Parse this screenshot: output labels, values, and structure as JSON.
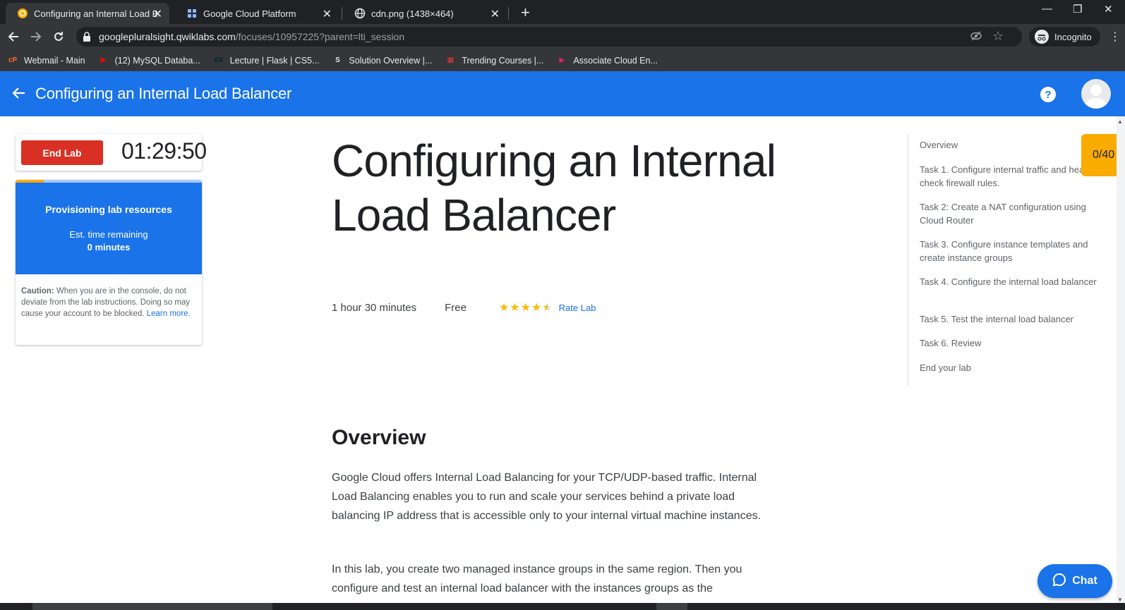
{
  "browser": {
    "tabs": [
      {
        "title": "Configuring an Internal Load Bala",
        "active": true
      },
      {
        "title": "Google Cloud Platform",
        "active": false
      },
      {
        "title": "cdn.png (1438×464)",
        "active": false
      }
    ],
    "url_host": "googlepluralsight.qwiklabs.com",
    "url_path": "/focuses/10957225?parent=lti_session",
    "incognito_label": "Incognito",
    "bookmarks": [
      {
        "label": "Webmail - Main",
        "icon": "cpanel-icon",
        "color": "#ff6c2c"
      },
      {
        "label": "(12) MySQL Databa...",
        "icon": "youtube-icon",
        "color": "#ff0000"
      },
      {
        "label": "Lecture | Flask | CS5...",
        "icon": "edx-icon",
        "color": "#02262b"
      },
      {
        "label": "Solution Overview |...",
        "icon": "s-icon",
        "color": "#e8eaed"
      },
      {
        "label": "Trending Courses |...",
        "icon": "gift-icon",
        "color": "#e53935"
      },
      {
        "label": "Associate Cloud En...",
        "icon": "play-icon",
        "color": "#e91e63"
      }
    ]
  },
  "header": {
    "title": "Configuring an Internal Load Balancer",
    "accent_color": "#1a73e8"
  },
  "lab_panel": {
    "end_label": "End Lab",
    "timer": "01:29:50",
    "provisioning_title": "Provisioning lab resources",
    "est_label": "Est. time remaining",
    "est_value": "0 minutes",
    "progress_fraction": 0.15,
    "caution_bold": "Caution:",
    "caution_text": " When you are in the console, do not deviate from the lab instructions. Doing so may cause your account to be blocked.",
    "learn_more": "Learn more."
  },
  "main": {
    "title": "Configuring an Internal Load Balancer",
    "duration": "1 hour 30 minutes",
    "price": "Free",
    "rating": 4.5,
    "rate_label": "Rate Lab",
    "overview_heading": "Overview",
    "paragraphs": [
      "Google Cloud offers Internal Load Balancing for your TCP/UDP-based traffic. Internal Load Balancing enables you to run and scale your services behind a private load balancing IP address that is accessible only to your internal virtual machine instances.",
      "In this lab, you create two managed instance groups in the same region. Then you configure and test an internal load balancer with the instances groups as the"
    ]
  },
  "toc": [
    "Overview",
    "Task 1. Configure internal traffic and health check firewall rules.",
    "Task 2: Create a NAT configuration using Cloud Router",
    "Task 3. Configure instance templates and create instance groups",
    "Task 4. Configure the internal load balancer",
    "Task 5. Test the internal load balancer",
    "Task 6. Review",
    "End your lab"
  ],
  "score": "0/40",
  "chat_label": "Chat"
}
